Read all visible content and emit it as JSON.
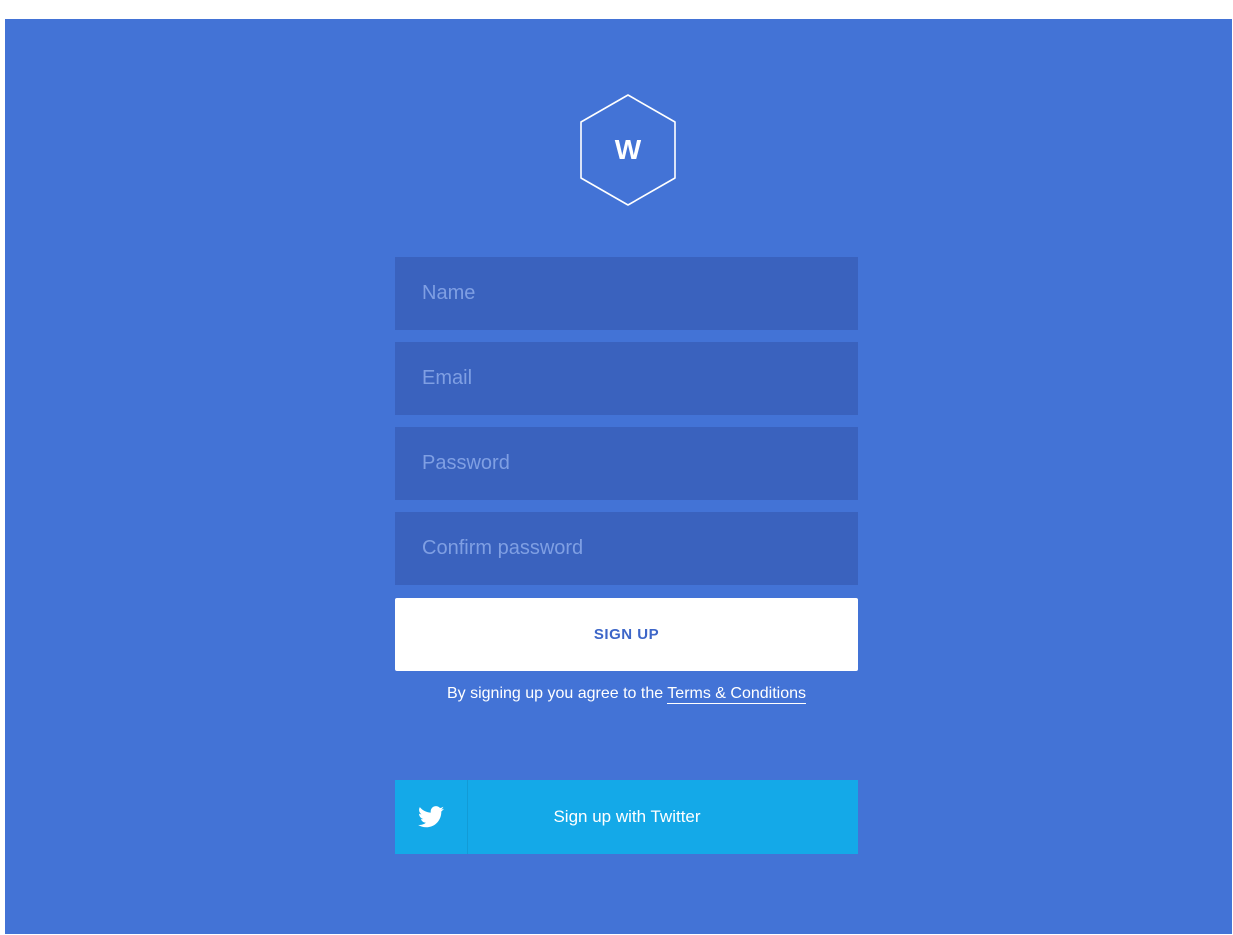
{
  "logo": {
    "letter": "W"
  },
  "form": {
    "name_placeholder": "Name",
    "email_placeholder": "Email",
    "password_placeholder": "Password",
    "confirm_placeholder": "Confirm password",
    "signup_label": "SIGN UP",
    "terms_prefix": "By signing up you agree to the ",
    "terms_link": "Terms & Conditions"
  },
  "social": {
    "twitter_label": "Sign up with Twitter",
    "twitter_icon": "twitter-bird-icon"
  },
  "colors": {
    "background": "#4373d6",
    "field": "#3a62be",
    "twitter": "#14a9e8"
  }
}
